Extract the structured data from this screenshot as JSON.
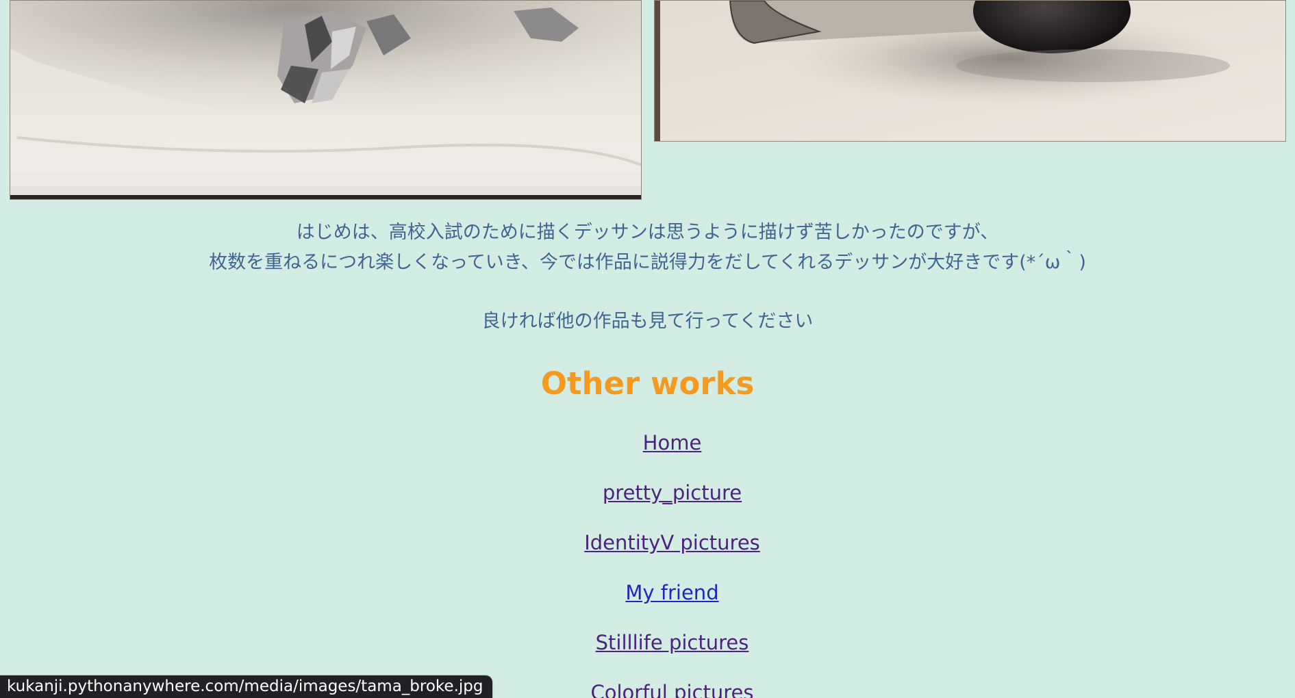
{
  "gallery": {
    "images": [
      {
        "label": "crumpled-foil-sketch"
      },
      {
        "label": "still-life-spheres-sketch"
      }
    ]
  },
  "text": {
    "intro_line1": "はじめは、高校入試のために描くデッサンは思うように描けず苦しかったのですが、",
    "intro_line2": "枚数を重ねるにつれ楽しくなっていき、今では作品に説得力をだしてくれるデッサンが大好きです(*´ω｀)",
    "invite": "良ければ他の作品も見て行ってください"
  },
  "other_works": {
    "title": "Other works",
    "links": [
      {
        "label": "Home"
      },
      {
        "label": "pretty_picture"
      },
      {
        "label": "IdentityV pictures"
      },
      {
        "label": "My friend"
      },
      {
        "label": "Stilllife pictures"
      },
      {
        "label": "Colorful pictures"
      }
    ]
  },
  "status_bar": {
    "url": "kukanji.pythonanywhere.com/media/images/tama_broke.jpg"
  }
}
